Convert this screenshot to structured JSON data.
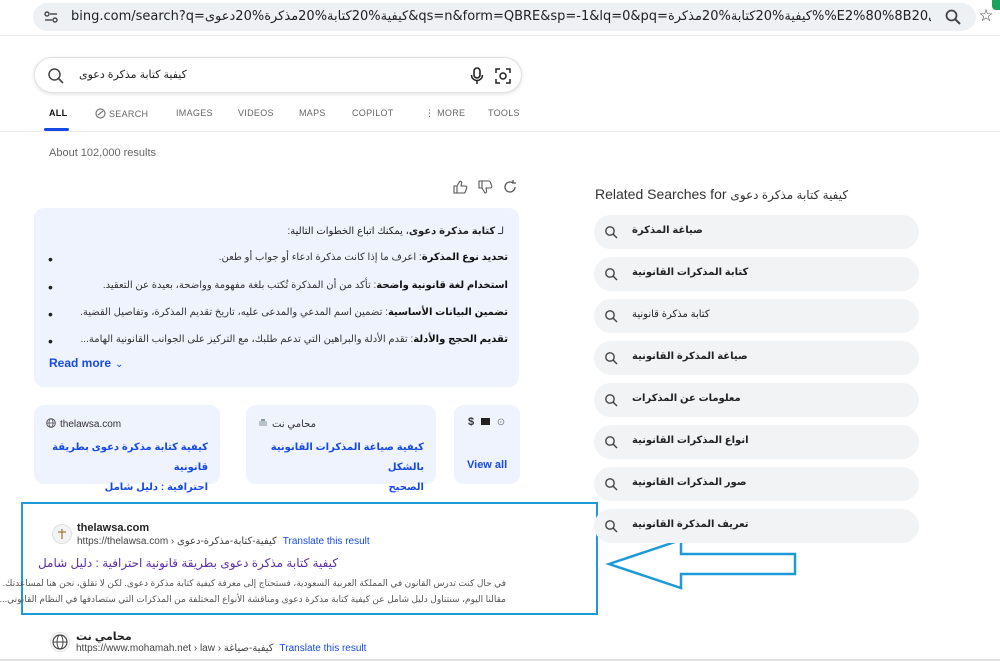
{
  "browser": {
    "url": "bing.com/search?q=كيفية%20كتابة%20مذكرة%20دعوى&qs=n&form=QBRE&sp=-1&lq=0&pq=كيفية%20كتابة%20مذكرة%%E2%80%8B20دعوى...",
    "icons": [
      "site-settings-icon",
      "zoom-icon",
      "star-icon"
    ]
  },
  "search": {
    "query": "كيفية كتابة مذكرة دعوى",
    "icons": [
      "search-icon",
      "microphone-icon",
      "visual-search-icon"
    ]
  },
  "tabs": [
    "ALL",
    "SEARCH",
    "IMAGES",
    "VIDEOS",
    "MAPS",
    "COPILOT",
    "MORE",
    "TOOLS"
  ],
  "results_count": "About 102,000 results",
  "answer": {
    "intro_bold": "كتابة مذكرة دعوى",
    "intro_prefix": "لـ",
    "intro_suffix": "، يمكنك اتباع الخطوات التالية:",
    "items": [
      {
        "bold": "تحديد نوع المذكرة",
        "text": ": اعرف ما إذا كانت مذكرة ادعاء أو جواب أو طعن."
      },
      {
        "bold": "استخدام لغة قانونية واضحة",
        "text": ": تأكد من أن المذكرة تُكتب بلغة مفهومة وواضحة، بعيدة عن التعقيد."
      },
      {
        "bold": "تضمين البيانات الأساسية",
        "text": ": تضمين اسم المدعي والمدعى عليه، تاريخ تقديم المذكرة، وتفاصيل القضية."
      },
      {
        "bold": "تقديم الحجج والأدلة",
        "text": ": تقدم الأدلة والبراهين التي تدعم طلبك، مع التركيز على الجوانب القانونية الهامة..."
      }
    ],
    "read_more": "Read more"
  },
  "cards": [
    {
      "site": "thelawsa.com",
      "title_line1": "كيفية كتابة مذكرة دعوى بطريقة قانونية",
      "title_line2": "احترافية : دليل شامل"
    },
    {
      "site": "محامي نت",
      "title_line1": "كيفية صياغة المذكرات القانونية بالشكل",
      "title_line2": "الصحيح"
    },
    {
      "site": "",
      "title_line1": "View all",
      "title_line2": ""
    }
  ],
  "results": [
    {
      "site": "thelawsa.com",
      "url": "https://thelawsa.com › كيفية-كتابة-مذكرة-دعوى",
      "translate": "Translate this result",
      "title": "كيفية كتابة مذكرة دعوى بطريقة قانونية احترافية : دليل شامل",
      "snippet1": "في حال كنت تدرس القانون في المملكة العربية السعودية، فستحتاج إلى معرفة كيفية كتابة مذكرة دعوى. لكن لا تقلق، نحن هنا لمساعدتك.",
      "snippet2": "مقالنا اليوم، سنتناول دليل شامل عن كيفية كتابة مذكرة دعوى ومناقشة الأنواع المختلفة من المذكرات التي ستصادفها في النظام القانوني..."
    },
    {
      "site": "محامي نت",
      "url": "https://www.mohamah.net › law › كيفية-صياغة",
      "translate": "Translate this result"
    }
  ],
  "related": {
    "title_prefix": "Related Searches for",
    "title_query": "كيفية كتابة مذكرة دعوى",
    "items": [
      "صياغة المذكرة",
      "كتابة المذكرات القانونية",
      "كتابة مذكرة قانونية",
      "صياغة المذكرة القانونية",
      "معلومات عن المذكرات",
      "انواع المذكرات القانونية",
      "صور المذكرات القانونية",
      "تعريف المذكرة القانونية"
    ]
  },
  "colors": {
    "accent": "#174ae4",
    "visited_title": "#5a2ea6",
    "highlight_border": "#1e9ad6",
    "answer_bg": "#eef3fd"
  }
}
